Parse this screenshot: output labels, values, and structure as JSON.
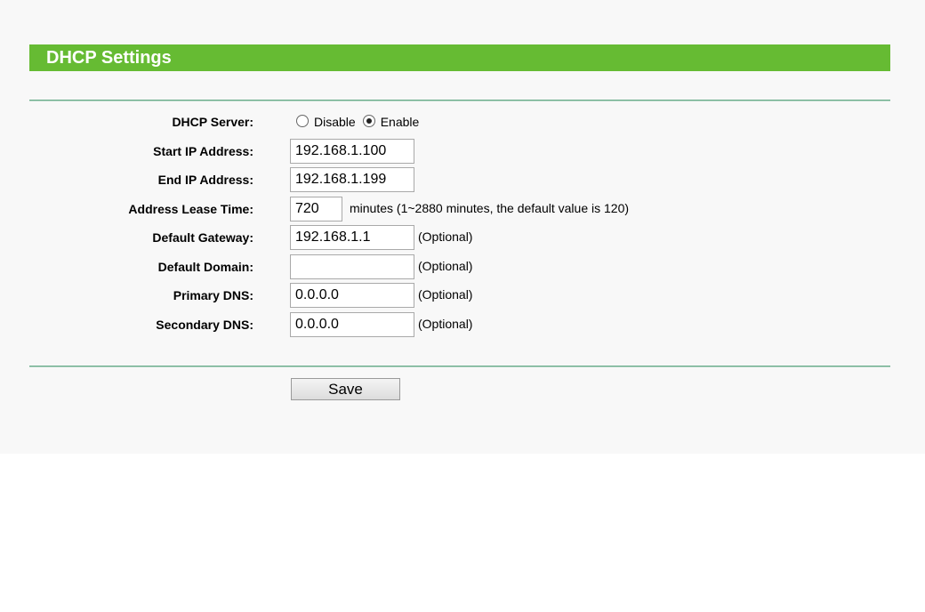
{
  "header": {
    "title": "DHCP Settings"
  },
  "dhcp_server": {
    "label": "DHCP Server:",
    "options": [
      "Disable",
      "Enable"
    ],
    "selected": "Enable"
  },
  "start_ip": {
    "label": "Start IP Address:",
    "value": "192.168.1.100"
  },
  "end_ip": {
    "label": "End IP Address:",
    "value": "192.168.1.199"
  },
  "lease_time": {
    "label": "Address Lease Time:",
    "value": "720",
    "hint": "minutes (1~2880 minutes, the default value is 120)"
  },
  "default_gateway": {
    "label": "Default Gateway:",
    "value": "192.168.1.1",
    "hint": "(Optional)"
  },
  "default_domain": {
    "label": "Default Domain:",
    "value": "",
    "hint": "(Optional)"
  },
  "primary_dns": {
    "label": "Primary DNS:",
    "value": "0.0.0.0",
    "hint": "(Optional)"
  },
  "secondary_dns": {
    "label": "Secondary DNS:",
    "value": "0.0.0.0",
    "hint": "(Optional)"
  },
  "actions": {
    "save_label": "Save"
  },
  "colors": {
    "header_bg": "#66bb33",
    "panel_bg": "#f8f8f8",
    "divider": "#66aa88"
  }
}
